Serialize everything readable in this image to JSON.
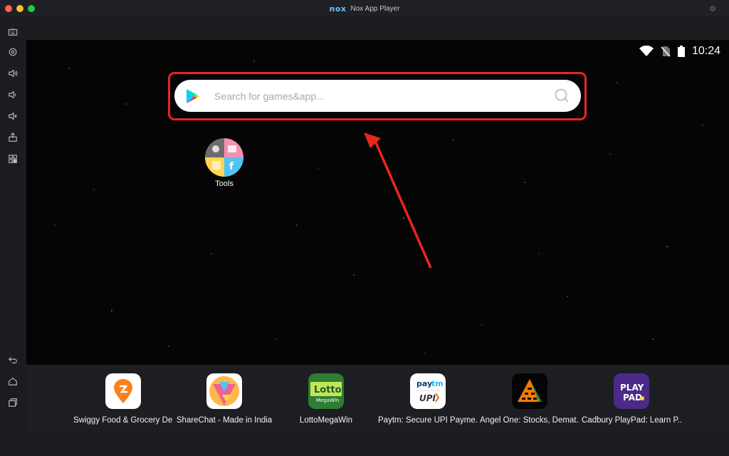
{
  "window": {
    "title": "Nox App Player",
    "logo_text": "nox"
  },
  "sidebar": {
    "items": [
      {
        "icon": "keyboard-icon"
      },
      {
        "icon": "location-icon"
      },
      {
        "icon": "volume-up-icon"
      },
      {
        "icon": "volume-down-icon"
      },
      {
        "icon": "mute-icon"
      },
      {
        "icon": "install-apk-icon"
      },
      {
        "icon": "multi-instance-icon"
      },
      {
        "icon": "back-icon"
      },
      {
        "icon": "home-icon"
      },
      {
        "icon": "recent-apps-icon"
      }
    ]
  },
  "statusbar": {
    "time": "10:24",
    "icons": [
      "wifi-icon",
      "no-sim-icon",
      "battery-icon"
    ]
  },
  "search": {
    "placeholder": "Search for games&app...",
    "value": "",
    "highlight_color": "#e8271d"
  },
  "desktop": {
    "apps": [
      {
        "label": "Tools",
        "icon": "tools-icon"
      }
    ]
  },
  "dock": {
    "apps": [
      {
        "label": "Swiggy Food & Grocery De...",
        "icon": "swiggy-icon",
        "color": "#ffffff"
      },
      {
        "label": "ShareChat - Made in India",
        "icon": "sharechat-icon",
        "color": "#ffffff"
      },
      {
        "label": "LottoMegaWin",
        "icon": "lotto-icon",
        "color": "#2e7d32"
      },
      {
        "label": "Paytm: Secure UPI Payme...",
        "icon": "paytm-icon",
        "color": "#ffffff"
      },
      {
        "label": "Angel One: Stocks, Demat...",
        "icon": "angel-one-icon",
        "color": "#050505"
      },
      {
        "label": "Cadbury PlayPad: Learn P...",
        "icon": "cadbury-icon",
        "color": "#4b2a8a"
      }
    ]
  },
  "annotation": {
    "arrow_color": "#e8271d"
  }
}
